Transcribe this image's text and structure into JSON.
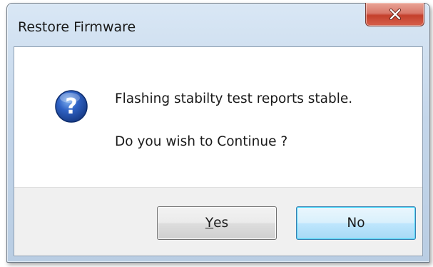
{
  "window": {
    "title": "Restore Firmware"
  },
  "icons": {
    "message_icon": "question-icon",
    "close_icon": "close-icon"
  },
  "message": {
    "line1": "Flashing stabilty test reports stable.",
    "line2": "Do you wish to Continue ?"
  },
  "buttons": {
    "yes_accel": "Y",
    "yes_rest": "es",
    "no_label": "No"
  },
  "colors": {
    "close_button": "#c4402c",
    "icon_blue": "#1f4fa8",
    "default_button_border": "#3c7fb1"
  }
}
